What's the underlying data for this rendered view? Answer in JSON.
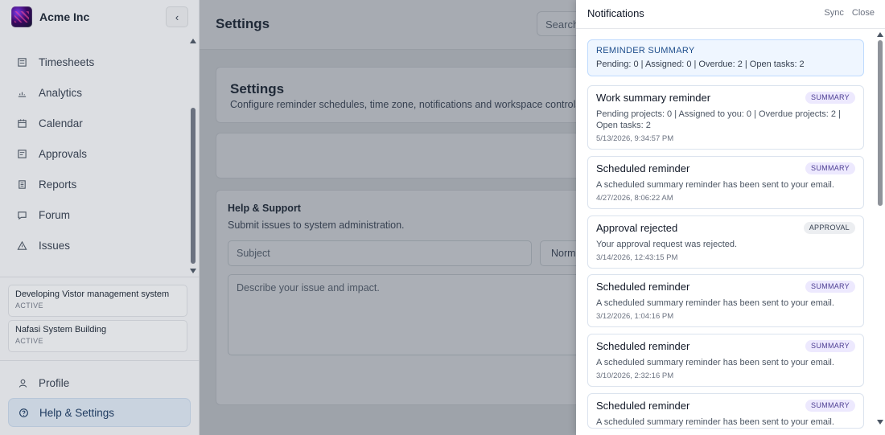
{
  "app": {
    "name": "Acme Inc"
  },
  "sidebar": {
    "items": [
      {
        "label": "Timesheets",
        "icon": "timesheet-icon"
      },
      {
        "label": "Analytics",
        "icon": "chart-icon"
      },
      {
        "label": "Calendar",
        "icon": "calendar-icon"
      },
      {
        "label": "Approvals",
        "icon": "approval-icon"
      },
      {
        "label": "Reports",
        "icon": "report-icon"
      },
      {
        "label": "Forum",
        "icon": "message-icon"
      },
      {
        "label": "Issues",
        "icon": "warning-icon"
      }
    ],
    "projects": [
      {
        "name": "Developing Vistor management system",
        "status": "ACTIVE"
      },
      {
        "name": "Nafasi System Building",
        "status": "ACTIVE"
      }
    ],
    "profile_label": "Profile",
    "help_label": "Help & Settings"
  },
  "main": {
    "title": "Settings",
    "search_placeholder": "Search",
    "settings_card": {
      "title": "Settings",
      "description": "Configure reminder schedules, time zone, notifications and workspace controls."
    },
    "support": {
      "title": "Help & Support",
      "subtitle": "Submit issues to system administration.",
      "subject_placeholder": "Subject",
      "priority_value": "Normal",
      "issue_placeholder": "Describe your issue and impact."
    }
  },
  "notifications": {
    "title": "Notifications",
    "sync_label": "Sync",
    "close_label": "Close",
    "summary": {
      "title": "REMINDER SUMMARY",
      "text": "Pending: 0 | Assigned: 0 | Overdue: 2 | Open tasks: 2"
    },
    "items": [
      {
        "title": "Work summary reminder",
        "badge": "SUMMARY",
        "body": "Pending projects: 0 | Assigned to you: 0 | Overdue projects: 2 | Open tasks: 2",
        "time": "5/13/2026, 9:34:57 PM"
      },
      {
        "title": "Scheduled reminder",
        "badge": "SUMMARY",
        "body": "A scheduled summary reminder has been sent to your email.",
        "time": "4/27/2026, 8:06:22 AM"
      },
      {
        "title": "Approval rejected",
        "badge": "APPROVAL",
        "body": "Your approval request was rejected.",
        "time": "3/14/2026, 12:43:15 PM"
      },
      {
        "title": "Scheduled reminder",
        "badge": "SUMMARY",
        "body": "A scheduled summary reminder has been sent to your email.",
        "time": "3/12/2026, 1:04:16 PM"
      },
      {
        "title": "Scheduled reminder",
        "badge": "SUMMARY",
        "body": "A scheduled summary reminder has been sent to your email.",
        "time": "3/10/2026, 2:32:16 PM"
      },
      {
        "title": "Scheduled reminder",
        "badge": "SUMMARY",
        "body": "A scheduled summary reminder has been sent to your email.",
        "time": ""
      }
    ]
  }
}
